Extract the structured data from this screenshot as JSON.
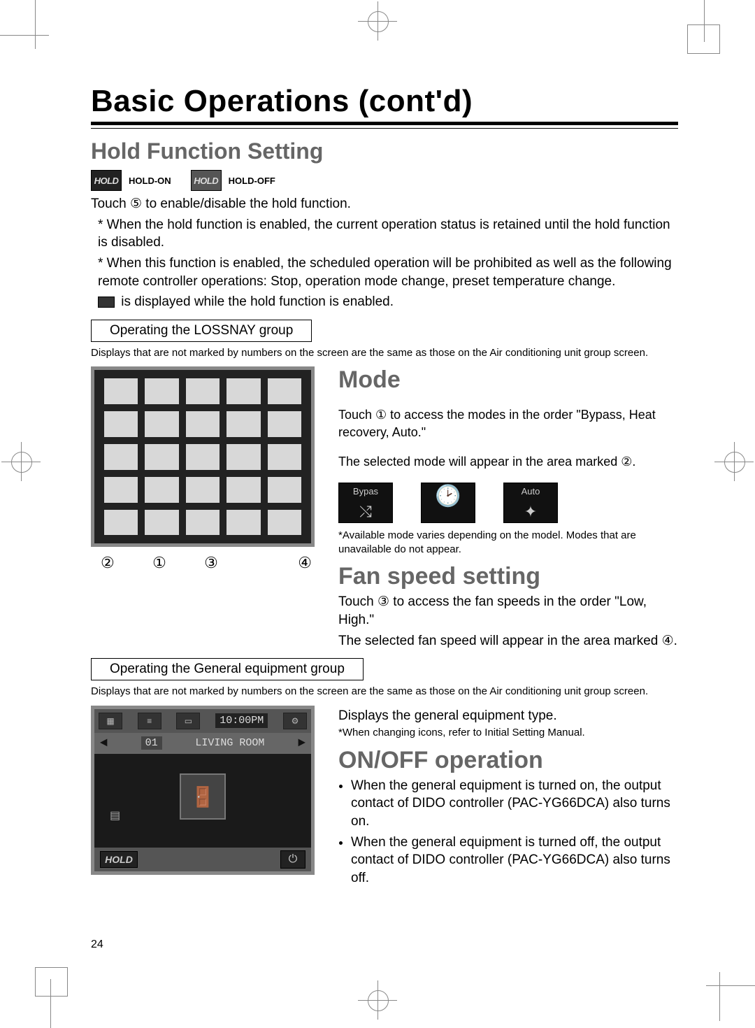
{
  "page_number": "24",
  "title": "Basic Operations (cont'd)",
  "hold_section": {
    "heading": "Hold Function Setting",
    "badge_on_text": "HOLD",
    "badge_on_label": "HOLD-ON",
    "badge_off_text": "HOLD",
    "badge_off_label": "HOLD-OFF",
    "line1": "Touch ⑤ to enable/disable the hold function.",
    "note1": "* When the hold function is enabled, the current operation status is retained until the hold function is disabled.",
    "note2": "* When this function is enabled, the scheduled operation will be prohibited as well as the following remote controller operations: Stop, operation mode change, preset temperature change.",
    "note3_suffix": " is displayed while the hold function is enabled."
  },
  "lossnay": {
    "box_label": "Operating the LOSSNAY group",
    "fine_print": "Displays that are not marked by numbers on the screen are the same as those on the Air conditioning unit group screen.",
    "callouts": {
      "a": "②",
      "b": "①",
      "c": "③",
      "d": "④"
    }
  },
  "mode": {
    "heading": "Mode",
    "line1": "Touch ① to access the modes in the order \"Bypass, Heat recovery, Auto.\"",
    "line2": "The selected mode will appear in the area marked ②.",
    "icons": {
      "bypass": "Bypas",
      "auto": "Auto"
    },
    "note": "*Available mode varies depending on the model. Modes that are unavailable do not appear."
  },
  "fan": {
    "heading": "Fan speed setting",
    "line1": "Touch ③ to access the fan speeds in the order \"Low, High.\"",
    "line2": "The selected fan speed will appear in the area marked ④."
  },
  "general": {
    "box_label": "Operating the General equipment group",
    "fine_print": "Displays that are not marked by numbers on the screen are the same as those on the Air conditioning unit group screen.",
    "screen": {
      "time": "10:00PM",
      "group_num": "01",
      "room_name": "LIVING ROOM",
      "hold_label": "HOLD"
    },
    "right_line1": "Displays the general equipment type.",
    "right_note": "*When changing icons, refer to Initial Setting Manual."
  },
  "onoff": {
    "heading": "ON/OFF operation",
    "bullet1": "When the general equipment is turned on, the output contact of DIDO controller (PAC-YG66DCA) also turns on.",
    "bullet2": "When the general equipment is turned off, the output contact of DIDO controller (PAC-YG66DCA) also turns off."
  }
}
